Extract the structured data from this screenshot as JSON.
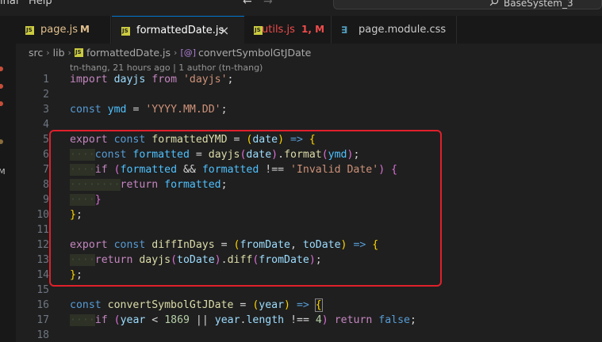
{
  "titlebar": {
    "menu_terminal": "inal",
    "menu_help": "Help",
    "back_arrow": "←",
    "forward_arrow": "→",
    "search_text": "BaseSystem_3"
  },
  "activity": {
    "badge": "M",
    "dot_colors": [
      "#c74e39",
      "#c74e39",
      "#c74e39",
      "#8a6d3b"
    ]
  },
  "tabs": [
    {
      "label": "page.js",
      "status": "M",
      "status_color": "#e2c08d",
      "label_color": "#e2c08d",
      "icon": "js-file-icon"
    },
    {
      "label": "formattedDate.js",
      "status": "",
      "label_color": "#ffffff",
      "icon": "js-file-icon",
      "close": "×"
    },
    {
      "label": "utils.js",
      "status": "1, M",
      "status_color": "#f14c4c",
      "label_color": "#f14c4c",
      "icon": "js-file-icon"
    },
    {
      "label": "page.module.css",
      "status": "",
      "label_color": "#cccccc",
      "icon": "css-file-icon"
    }
  ],
  "breadcrumb": {
    "src": "src",
    "lib": "lib",
    "file": "formattedDate.js",
    "symbol": "convertSymbolGtJDate"
  },
  "blame": "tn-thang, 21 hours ago | 1 author (tn-thang)",
  "line_numbers": [
    "1",
    "2",
    "3",
    "4",
    "5",
    "6",
    "7",
    "8",
    "9",
    "10",
    "11",
    "12",
    "13",
    "14",
    "15",
    "16",
    "17",
    "18"
  ],
  "code": {
    "l1": {
      "kw": "import",
      "name": "dayjs",
      "from": "from",
      "str": "'dayjs'",
      "end": ";"
    },
    "l3": {
      "kw": "const",
      "name": "ymd",
      "eq": "=",
      "str": "'YYYY.MM.DD'",
      "end": ";"
    },
    "l5": {
      "exp": "export",
      "kw": "const",
      "name": "formattedYMD",
      "eq": "=",
      "lp": "(",
      "param": "date",
      "rp": ")",
      "arrow": "=>",
      "brace": "{"
    },
    "l6": {
      "ws": "····",
      "kw": "const",
      "name": "formatted",
      "eq": "=",
      "fn": "dayjs",
      "lp": "(",
      "arg": "date",
      "rp": ")",
      "dot": ".",
      "fn2": "format",
      "lp2": "(",
      "arg2": "ymd",
      "rp2": ")",
      "end": ";"
    },
    "l7": {
      "ws": "····",
      "kw": "if",
      "lp": "(",
      "v1": "formatted",
      "and": "&&",
      "v2": "formatted",
      "neq": "!==",
      "str": "'Invalid Date'",
      "rp": ")",
      "brace": "{"
    },
    "l8": {
      "ws": "········",
      "kw": "return",
      "name": "formatted",
      "end": ";"
    },
    "l9": {
      "ws": "····",
      "brace": "}"
    },
    "l10": {
      "brace": "}",
      "end": ";"
    },
    "l12": {
      "exp": "export",
      "kw": "const",
      "name": "diffInDays",
      "eq": "=",
      "lp": "(",
      "p1": "fromDate",
      "comma": ",",
      "p2": "toDate",
      "rp": ")",
      "arrow": "=>",
      "brace": "{"
    },
    "l13": {
      "ws": "····",
      "kw": "return",
      "fn": "dayjs",
      "lp": "(",
      "arg": "toDate",
      "rp": ")",
      "dot": ".",
      "fn2": "diff",
      "lp2": "(",
      "arg2": "fromDate",
      "rp2": ")",
      "end": ";"
    },
    "l14": {
      "brace": "}",
      "end": ";"
    },
    "l16": {
      "kw": "const",
      "name": "convertSymbolGtJDate",
      "eq": "=",
      "lp": "(",
      "param": "year",
      "rp": ")",
      "arrow": "=>",
      "brace": "{"
    },
    "l17": {
      "ws": "····",
      "kw": "if",
      "lp": "(",
      "v1": "year",
      "lt": "<",
      "num": "1869",
      "or": "||",
      "v2": "year",
      "dot": ".",
      "prop": "length",
      "neq": "!==",
      "num2": "4",
      "rp": ")",
      "ret": "return",
      "fals": "false",
      "end": ";"
    }
  }
}
